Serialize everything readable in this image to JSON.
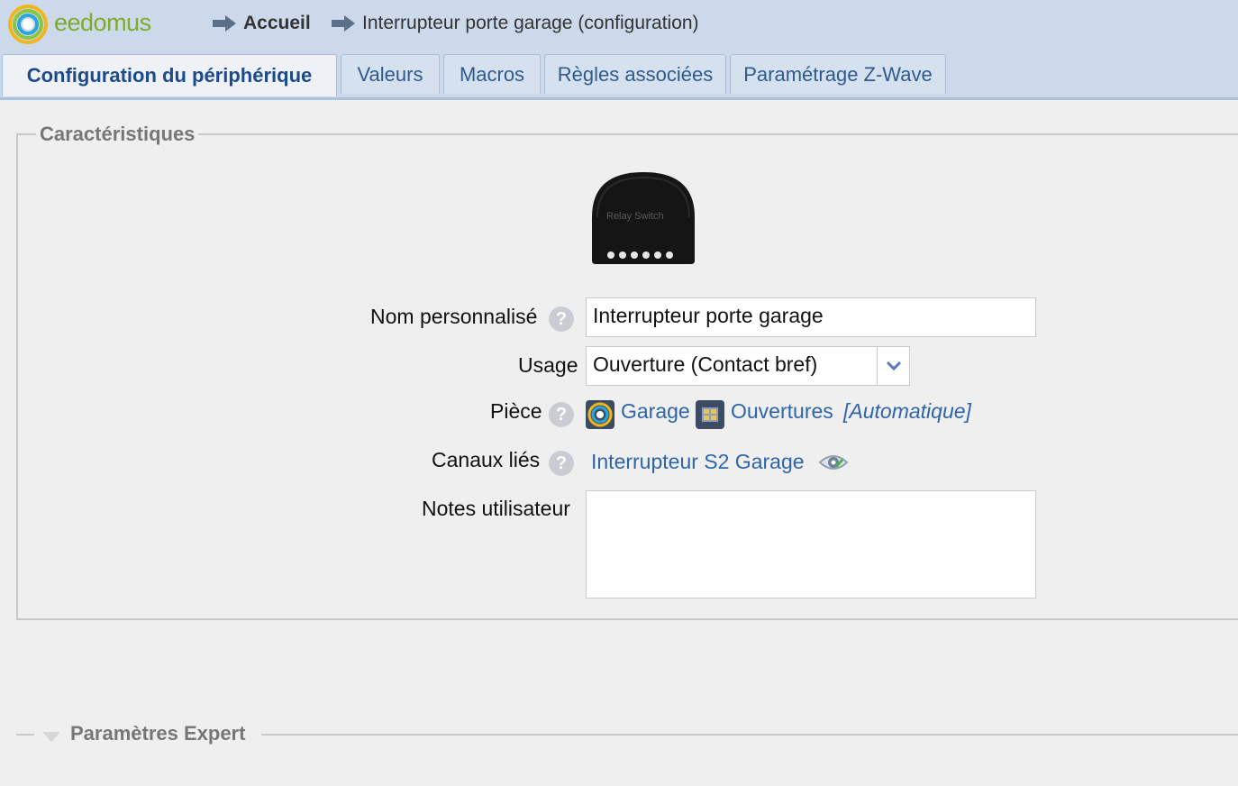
{
  "header": {
    "logo_text": "eedomus",
    "breadcrumb_home": "Accueil",
    "breadcrumb_page": "Interrupteur porte garage (configuration)"
  },
  "tabs": [
    {
      "label": "Configuration du périphérique",
      "active": true
    },
    {
      "label": "Valeurs",
      "active": false
    },
    {
      "label": "Macros",
      "active": false
    },
    {
      "label": "Règles associées",
      "active": false
    },
    {
      "label": "Paramétrage Z-Wave",
      "active": false
    }
  ],
  "caracteristiques": {
    "legend": "Caractéristiques",
    "device_image_text": "Relay Switch",
    "fields": {
      "nom_label": "Nom personnalisé",
      "nom_value": "Interrupteur porte garage",
      "usage_label": "Usage",
      "usage_value": "Ouverture (Contact bref)",
      "piece_label": "Pièce",
      "piece_room": "Garage",
      "piece_category": "Ouvertures",
      "piece_mode": "[Automatique]",
      "canaux_label": "Canaux liés",
      "canaux_value": "Interrupteur S2 Garage",
      "notes_label": "Notes utilisateur",
      "notes_value": ""
    },
    "help_symbol": "?"
  },
  "expert": {
    "title": "Paramètres Expert"
  },
  "colors": {
    "header_bg": "#ccd9ea",
    "link": "#2e64a8",
    "logo_green": "#7dac2d"
  }
}
